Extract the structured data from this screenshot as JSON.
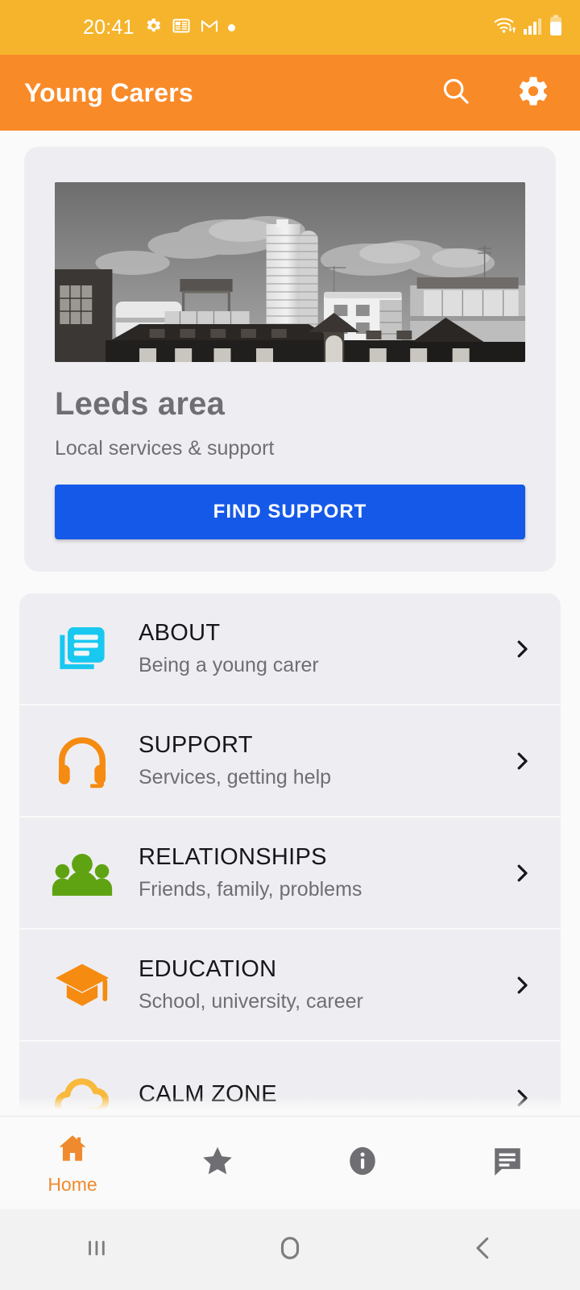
{
  "status_bar": {
    "time": "20:41",
    "left_icons": [
      "settings-gear-icon",
      "news-widget-icon",
      "gmail-icon",
      "notification-dot-icon"
    ],
    "right_icons": [
      "wifi-icon",
      "cellular-signal-icon",
      "battery-icon"
    ],
    "background_color": "#F5B42B"
  },
  "app_bar": {
    "title": "Young Carers",
    "search_icon": "search-icon",
    "settings_icon": "gear-icon",
    "background_color": "#F98A28"
  },
  "hero": {
    "image_alt": "Leeds city skyline black and white photograph",
    "title": "Leeds area",
    "subtitle": "Local services & support",
    "button_label": "FIND SUPPORT",
    "button_color": "#1559E8"
  },
  "menu": {
    "items": [
      {
        "title": "ABOUT",
        "subtitle": "Being a young carer",
        "icon": "articles-icon",
        "icon_color": "#18C8F0"
      },
      {
        "title": "SUPPORT",
        "subtitle": "Services, getting help",
        "icon": "headset-icon",
        "icon_color": "#F58B10"
      },
      {
        "title": "RELATIONSHIPS",
        "subtitle": "Friends, family, problems",
        "icon": "people-group-icon",
        "icon_color": "#5FA313"
      },
      {
        "title": "EDUCATION",
        "subtitle": "School, university, career",
        "icon": "graduation-cap-icon",
        "icon_color": "#F58B10"
      },
      {
        "title": "CALM ZONE",
        "subtitle": "",
        "icon": "cloud-icon",
        "icon_color": "#F8B93C"
      }
    ],
    "chevron_icon": "chevron-right-icon"
  },
  "bottom_nav": {
    "items": [
      {
        "label": "Home",
        "icon": "home-icon",
        "active": "true"
      },
      {
        "label": "",
        "icon": "star-icon",
        "active": "false"
      },
      {
        "label": "",
        "icon": "info-icon",
        "active": "false"
      },
      {
        "label": "",
        "icon": "chat-icon",
        "active": "false"
      }
    ],
    "active_color": "#F08A2E",
    "inactive_color": "#6E6E73"
  },
  "system_nav": {
    "recents_icon": "recents-icon",
    "home_icon": "home-circle-icon",
    "back_icon": "back-chevron-icon"
  }
}
